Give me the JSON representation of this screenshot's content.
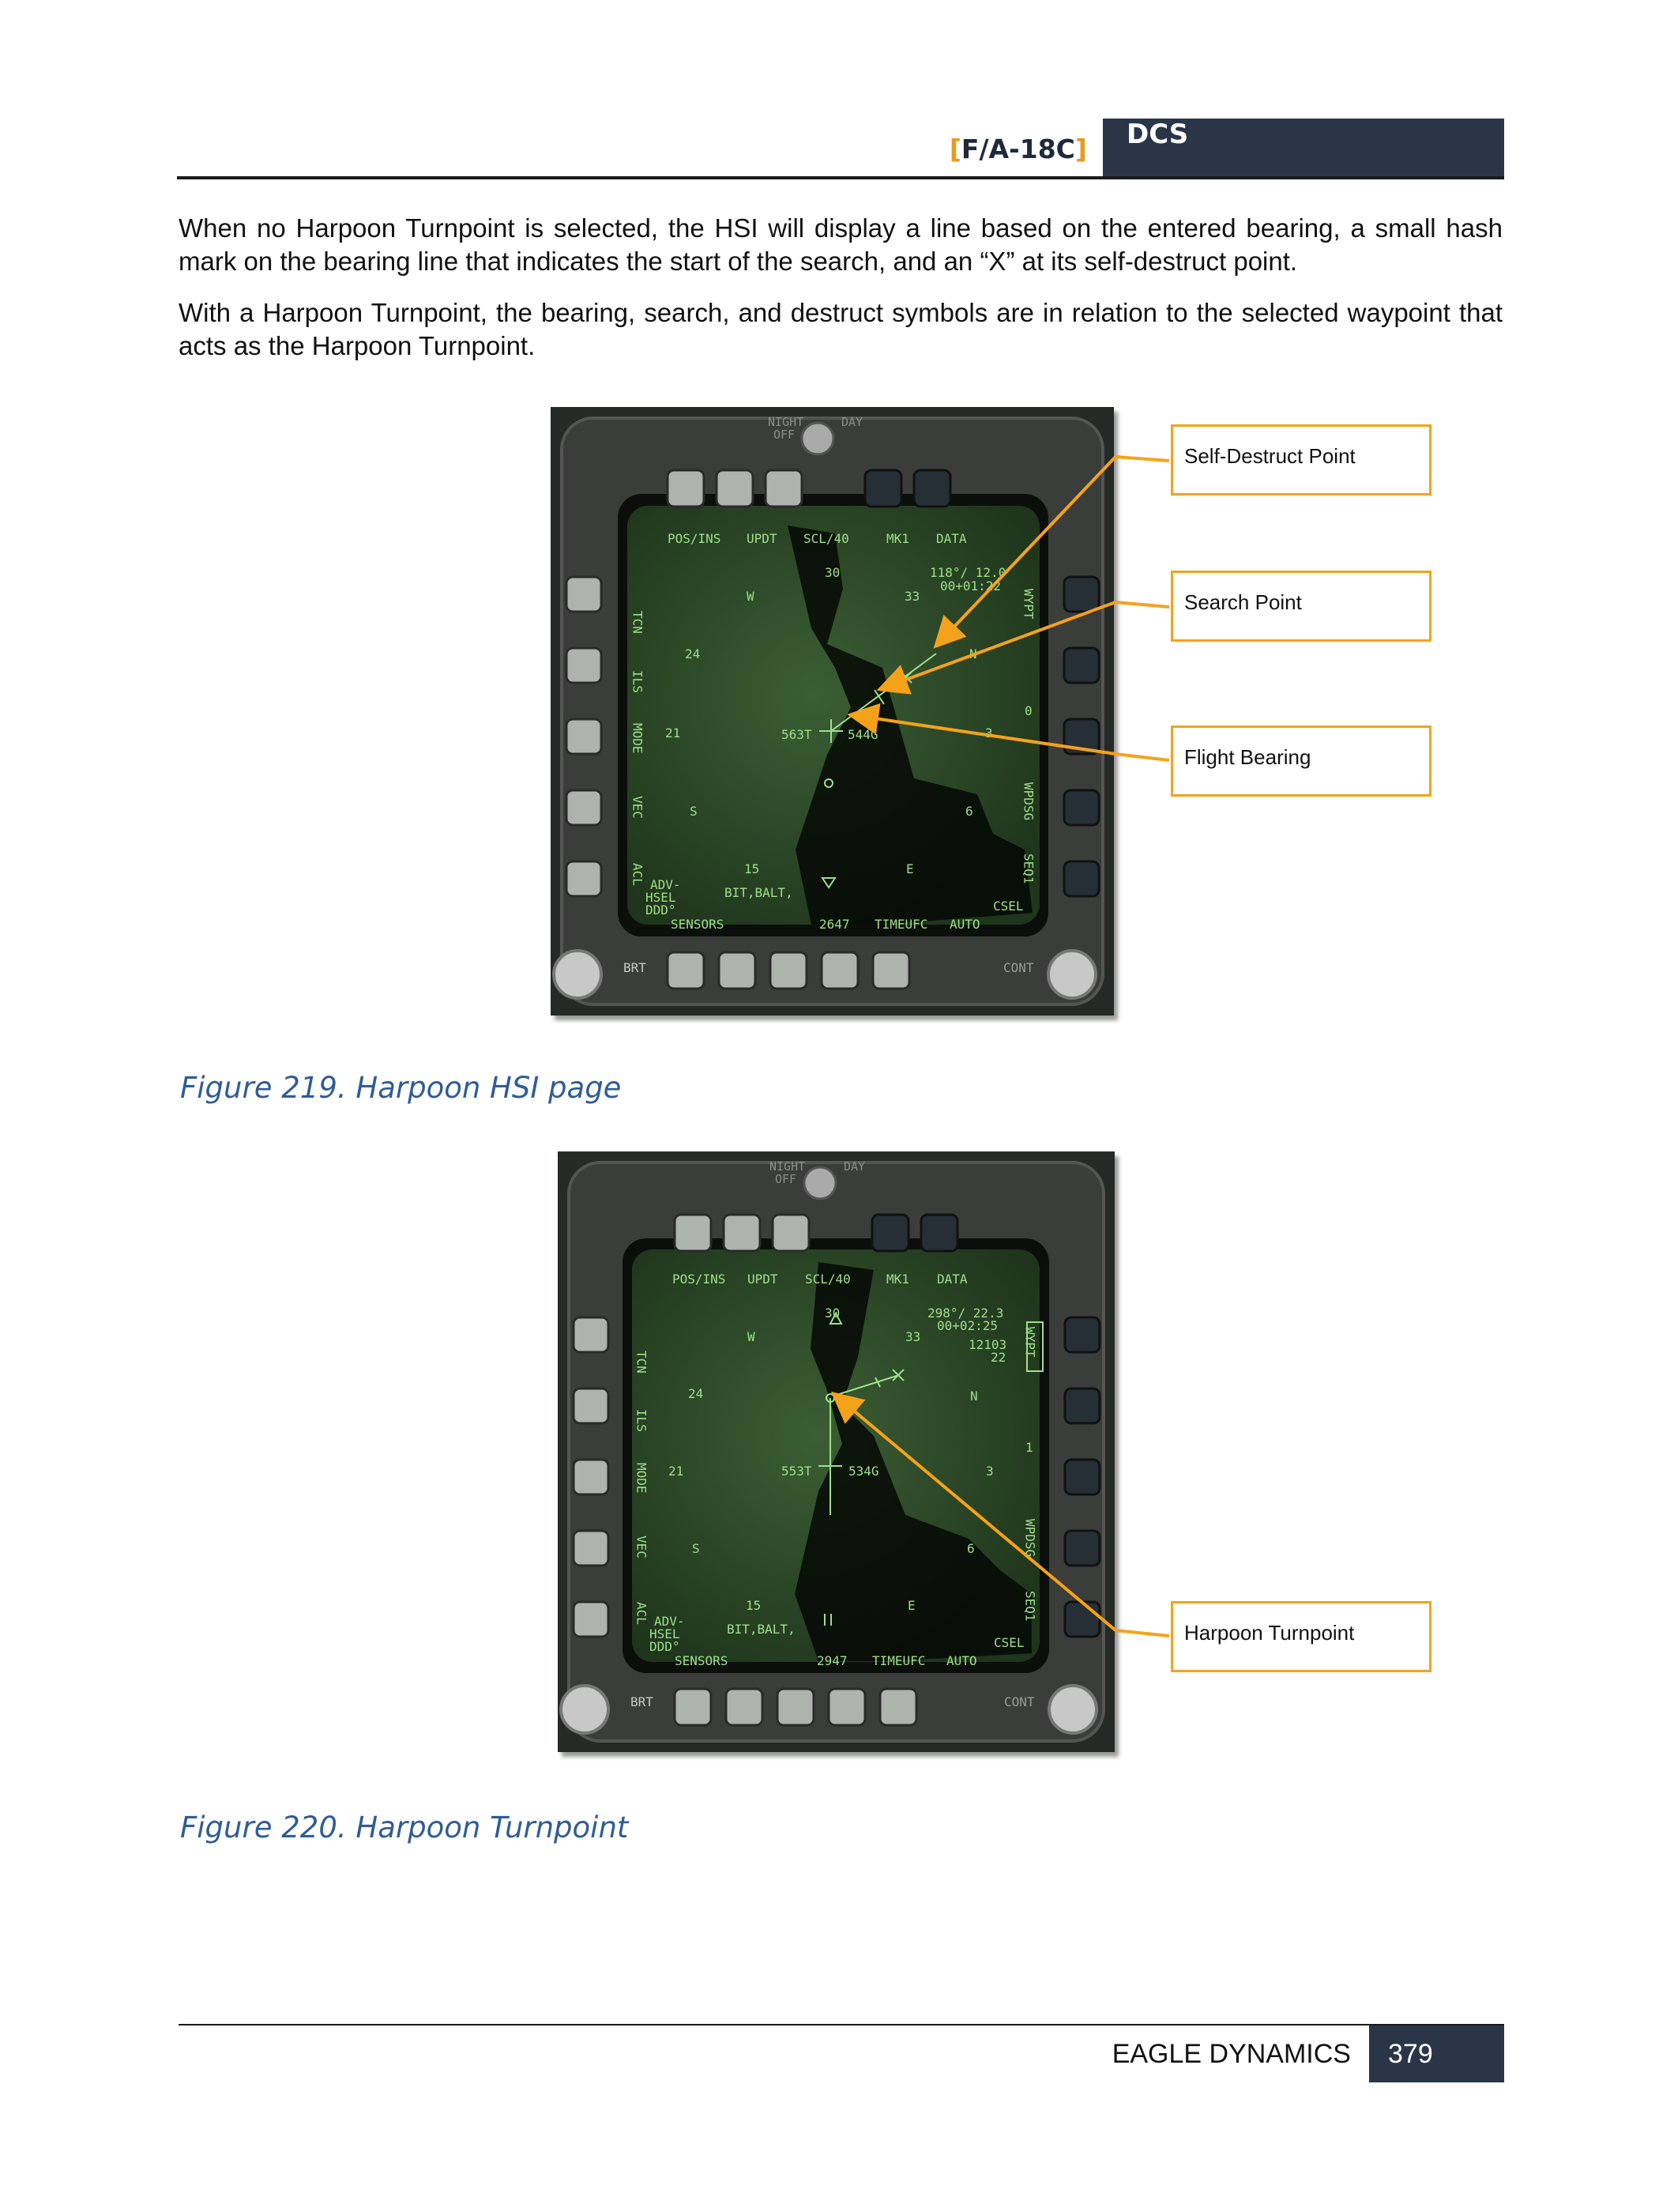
{
  "header": {
    "bracket_open": "[",
    "aircraft": "F/A-18C",
    "bracket_close": "]",
    "brand": "DCS"
  },
  "paragraphs": [
    "When no Harpoon Turnpoint is selected, the HSI will display a line based on the entered bearing, a small hash mark on the bearing line that indicates the start of the search, and an “X” at its self-destruct point.",
    "With a Harpoon Turnpoint, the bearing, search, and destruct symbols are in relation to the selected waypoint that acts as the Harpoon Turnpoint."
  ],
  "figures": [
    {
      "caption": "Figure 219. Harpoon HSI page",
      "callouts": [
        "Self-Destruct Point",
        "Search Point",
        "Flight Bearing"
      ],
      "mfd": {
        "top_options": [
          "POS/INS",
          "UPDT",
          "SCL/40",
          "MK1",
          "DATA"
        ],
        "bottom_options": [
          "SENSORS",
          "2647",
          "TIMEUFC",
          "AUTO"
        ],
        "left_labels": [
          "TCN",
          "ILS",
          "MODE",
          "VEC",
          "ACL"
        ],
        "right_labels": [
          "WYPT",
          "0",
          "WPDSG",
          "SEQ1"
        ],
        "bearing_readout": "118°/ 12.0",
        "time_readout": "00+01:22",
        "true_speed": "563T",
        "ground_speed": "544G",
        "compass": [
          "30",
          "33",
          "W",
          "24",
          "21",
          "S",
          "15",
          "E",
          "6",
          "3",
          "N"
        ],
        "status_lines": [
          "ADV-",
          "HSEL",
          "DDD°",
          "BIT,BALT,",
          "CSEL"
        ],
        "knob_labels": [
          "NIGHT",
          "OFF",
          "DAY",
          "BRT",
          "CONT"
        ]
      }
    },
    {
      "caption": "Figure 220. Harpoon Turnpoint",
      "callouts": [
        "Harpoon Turnpoint"
      ],
      "mfd": {
        "top_options": [
          "POS/INS",
          "UPDT",
          "SCL/40",
          "MK1",
          "DATA"
        ],
        "bottom_options": [
          "SENSORS",
          "2947",
          "TIMEUFC",
          "AUTO"
        ],
        "left_labels": [
          "TCN",
          "ILS",
          "MODE",
          "VEC",
          "ACL"
        ],
        "right_labels": [
          "WYPT",
          "1",
          "WPDSG",
          "SEQ1"
        ],
        "bearing_readout": "298°/ 22.3",
        "time_readout": "00+02:25",
        "extra_readout": [
          "12103",
          "22"
        ],
        "true_speed": "553T",
        "ground_speed": "534G",
        "compass": [
          "30",
          "33",
          "W",
          "24",
          "21",
          "S",
          "15",
          "E",
          "6",
          "3",
          "N"
        ],
        "status_lines": [
          "ADV-",
          "HSEL",
          "DDD°",
          "BIT,BALT,",
          "CSEL"
        ],
        "knob_labels": [
          "NIGHT",
          "OFF",
          "DAY",
          "BRT",
          "CONT"
        ]
      }
    }
  ],
  "footer": {
    "company": "EAGLE DYNAMICS",
    "page_number": "379"
  },
  "colors": {
    "header_box": "#2a3648",
    "accent_orange": "#f5a21b",
    "caption_blue": "#2f5d94",
    "mfd_symbology": "#9ee08a"
  }
}
